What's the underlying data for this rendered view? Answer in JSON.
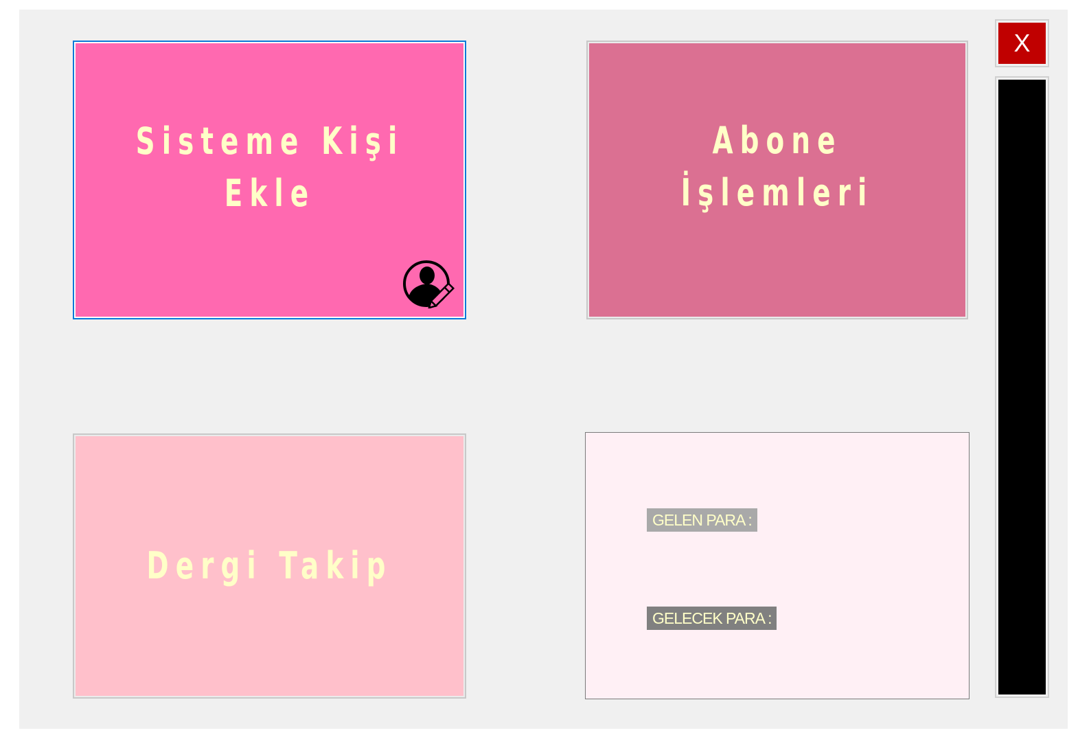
{
  "tiles": {
    "add_person": {
      "label": "Sisteme  Kişi Ekle",
      "icon": "user-edit-icon",
      "color": "#ff69b0"
    },
    "subscriber_ops": {
      "label": "Abone İşlemleri",
      "color": "#db7092"
    },
    "magazine_tracking": {
      "label": "Dergi Takip",
      "color": "#ffc0cb"
    }
  },
  "money_panel": {
    "incoming_label": "GELEN PARA :",
    "expected_label": "GELECEK PARA :",
    "color": "#fff0f5"
  },
  "close_button": {
    "label": "X",
    "color": "#c00000"
  },
  "side_panel": {
    "color": "#000000"
  },
  "accent": {
    "focus_border": "#0a78d7",
    "tile_text": "#ffffc8"
  }
}
